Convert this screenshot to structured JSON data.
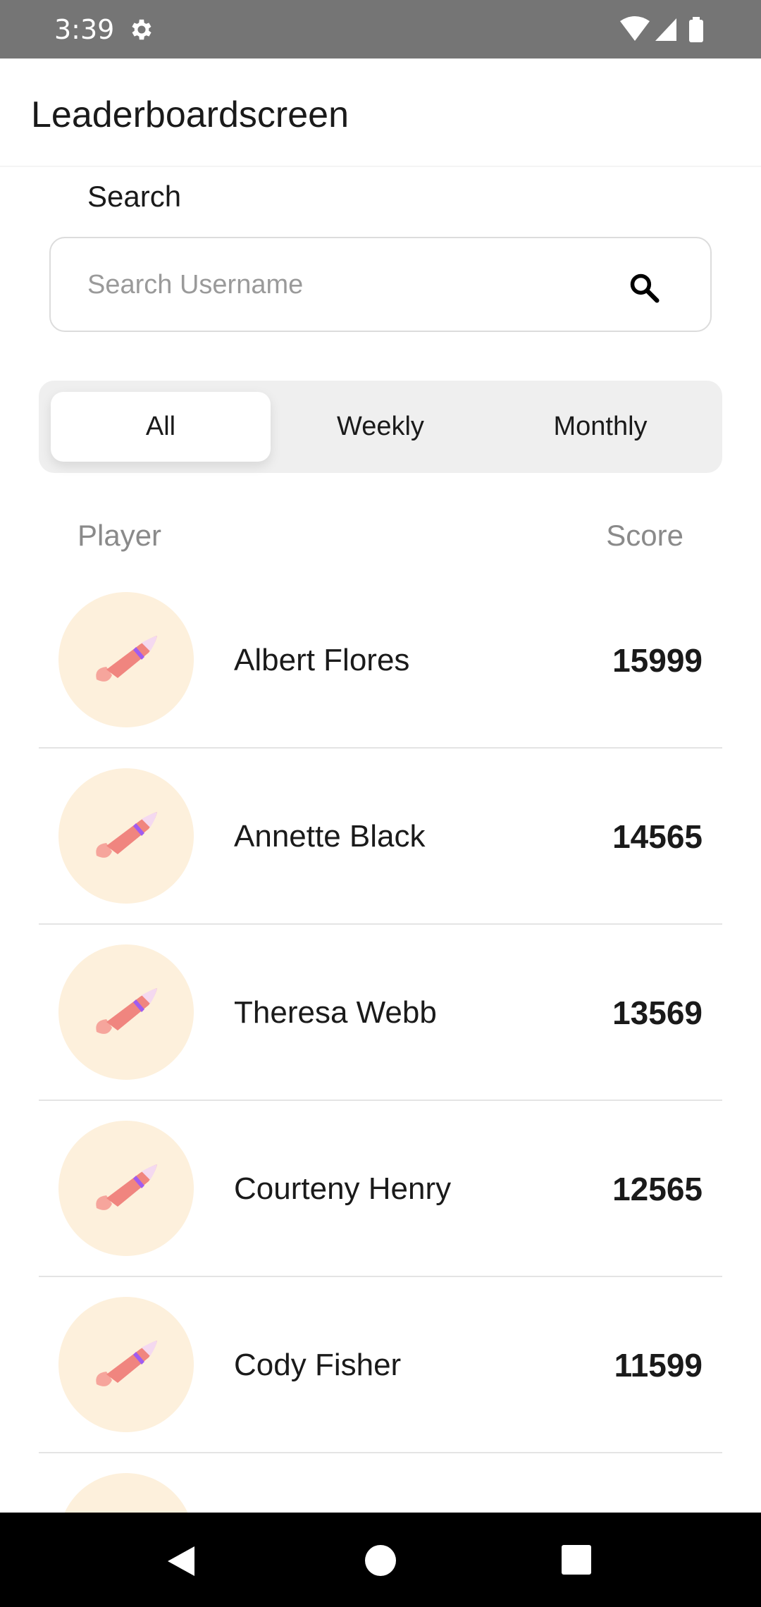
{
  "status_bar": {
    "time": "3:39"
  },
  "app_bar": {
    "title": "Leaderboardscreen"
  },
  "search": {
    "label": "Search",
    "placeholder": "Search Username",
    "value": ""
  },
  "tabs": [
    {
      "label": "All",
      "active": true
    },
    {
      "label": "Weekly",
      "active": false
    },
    {
      "label": "Monthly",
      "active": false
    }
  ],
  "table": {
    "player_header": "Player",
    "score_header": "Score",
    "rows": [
      {
        "name": "Albert Flores",
        "score": "15999",
        "avatar": "rocket-icon"
      },
      {
        "name": "Annette Black",
        "score": "14565",
        "avatar": "rocket-icon"
      },
      {
        "name": "Theresa Webb",
        "score": "13569",
        "avatar": "rocket-icon"
      },
      {
        "name": "Courteny Henry",
        "score": "12565",
        "avatar": "rocket-icon"
      },
      {
        "name": "Cody Fisher",
        "score": "11599",
        "avatar": "rocket-icon"
      }
    ]
  },
  "colors": {
    "status_bar": "#757575",
    "avatar_bg": "#fdf0dc",
    "tab_track": "#efefef",
    "rocket_body": "#f0857f",
    "rocket_band": "#a05cf0"
  }
}
